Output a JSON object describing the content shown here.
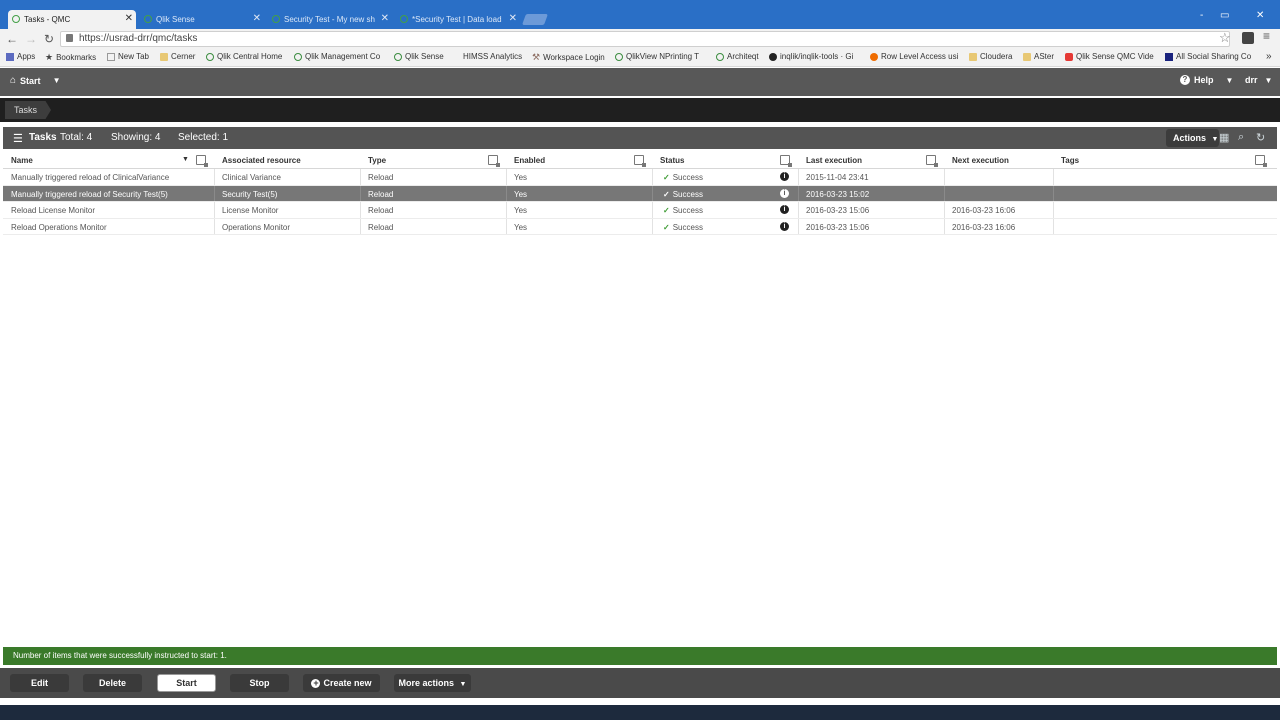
{
  "browser": {
    "tabs": [
      {
        "title": "Tasks - QMC",
        "active": true
      },
      {
        "title": "Qlik Sense",
        "active": false
      },
      {
        "title": "Security Test - My new sh",
        "active": false
      },
      {
        "title": "*Security Test | Data load",
        "active": false
      }
    ],
    "window_controls": [
      "‑",
      "▭",
      "✕"
    ],
    "url": "https://usrad-drr/qmc/tasks",
    "bookmarks": [
      {
        "label": "Apps",
        "icon": "apps-grid-icon"
      },
      {
        "label": "Bookmarks",
        "icon": "star-icon"
      },
      {
        "label": "New Tab",
        "icon": "page-icon"
      },
      {
        "label": "Cerner",
        "icon": "folder-icon"
      },
      {
        "label": "Qlik Central Home",
        "icon": "qlik-icon"
      },
      {
        "label": "Qlik Management Co",
        "icon": "qlik-icon"
      },
      {
        "label": "Qlik Sense",
        "icon": "qlik-icon"
      },
      {
        "label": "HIMSS Analytics",
        "icon": "page-icon"
      },
      {
        "label": "Workspace Login",
        "icon": "workspace-icon"
      },
      {
        "label": "QlikView NPrinting T",
        "icon": "qlik-icon"
      },
      {
        "label": "Architeqt",
        "icon": "qlik-icon"
      },
      {
        "label": "inqlik/inqlik-tools · Gi",
        "icon": "github-icon"
      },
      {
        "label": "Row Level Access usi",
        "icon": "page-icon"
      },
      {
        "label": "Cloudera",
        "icon": "folder-icon"
      },
      {
        "label": "ASter",
        "icon": "folder-icon"
      },
      {
        "label": "Qlik Sense QMC Vide",
        "icon": "youtube-icon"
      },
      {
        "label": "All Social Sharing Co",
        "icon": "x-icon"
      }
    ]
  },
  "qmc": {
    "start_label": "Start",
    "help_label": "Help",
    "user_label": "drr",
    "breadcrumb": "Tasks",
    "list_title": "Tasks",
    "total": "Total: 4",
    "showing": "Showing: 4",
    "selected": "Selected: 1",
    "actions_label": "Actions",
    "columns": [
      "Name",
      "Associated resource",
      "Type",
      "Enabled",
      "Status",
      "Last execution",
      "Next execution",
      "Tags"
    ],
    "rows": [
      {
        "name": "Manually triggered reload of ClinicalVariance",
        "resource": "Clinical Variance",
        "type": "Reload",
        "enabled": "Yes",
        "status": "Success",
        "last": "2015-11-04 23:41",
        "next": "",
        "tags": "",
        "selected": false
      },
      {
        "name": "Manually triggered reload of Security Test(5)",
        "resource": "Security Test(5)",
        "type": "Reload",
        "enabled": "Yes",
        "status": "Success",
        "last": "2016-03-23 15:02",
        "next": "",
        "tags": "",
        "selected": true
      },
      {
        "name": "Reload License Monitor",
        "resource": "License Monitor",
        "type": "Reload",
        "enabled": "Yes",
        "status": "Success",
        "last": "2016-03-23 15:06",
        "next": "2016-03-23 16:06",
        "tags": "",
        "selected": false
      },
      {
        "name": "Reload Operations Monitor",
        "resource": "Operations Monitor",
        "type": "Reload",
        "enabled": "Yes",
        "status": "Success",
        "last": "2016-03-23 15:06",
        "next": "2016-03-23 16:06",
        "tags": "",
        "selected": false
      }
    ],
    "status_message": "Number of items that were successfully instructed to start: 1.",
    "buttons": {
      "edit": "Edit",
      "delete": "Delete",
      "start": "Start",
      "stop": "Stop",
      "create_new": "Create new",
      "more_actions": "More actions"
    }
  },
  "colors": {
    "browser_blue": "#2a6fc6",
    "header_grey": "#585858",
    "success_green": "#3f9c35",
    "status_bar_green": "#3a7a2a"
  }
}
